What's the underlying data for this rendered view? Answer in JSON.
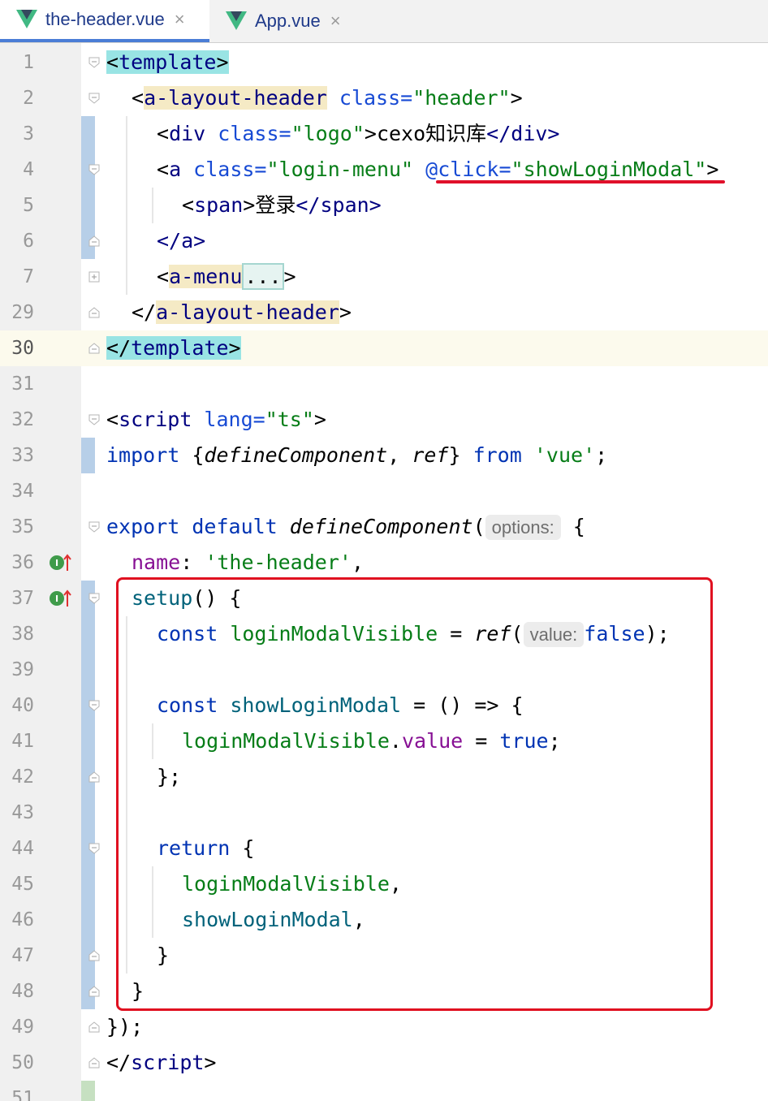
{
  "tabs": [
    {
      "label": "the-header.vue",
      "active": true
    },
    {
      "label": "App.vue",
      "active": false
    }
  ],
  "close_glyph": "×",
  "lines": [
    {
      "num": "1"
    },
    {
      "num": "2"
    },
    {
      "num": "3"
    },
    {
      "num": "4"
    },
    {
      "num": "5"
    },
    {
      "num": "6"
    },
    {
      "num": "7"
    },
    {
      "num": "29"
    },
    {
      "num": "30"
    },
    {
      "num": "31"
    },
    {
      "num": "32"
    },
    {
      "num": "33"
    },
    {
      "num": "34"
    },
    {
      "num": "35"
    },
    {
      "num": "36"
    },
    {
      "num": "37"
    },
    {
      "num": "38"
    },
    {
      "num": "39"
    },
    {
      "num": "40"
    },
    {
      "num": "41"
    },
    {
      "num": "42"
    },
    {
      "num": "43"
    },
    {
      "num": "44"
    },
    {
      "num": "45"
    },
    {
      "num": "46"
    },
    {
      "num": "47"
    },
    {
      "num": "48"
    },
    {
      "num": "49"
    },
    {
      "num": "50"
    },
    {
      "num": "51"
    }
  ],
  "code": {
    "l1": {
      "lt": "<",
      "tag": "template",
      "gt": ">"
    },
    "l2": {
      "lt": "<",
      "tag": "a-layout-header",
      "attr": " class=",
      "val": "\"header\"",
      "gt": ">"
    },
    "l3": {
      "lt": "<",
      "tag": "div",
      "attr": " class=",
      "val": "\"logo\"",
      "gt": ">",
      "text": "cexo知识库",
      "close": "</div>"
    },
    "l4": {
      "lt": "<",
      "tag": "a",
      "attr": " class=",
      "val": "\"login-menu\"",
      "event": "@click=",
      "handler": "\"showLoginModal\"",
      "gt": ">"
    },
    "l5": {
      "lt": "<",
      "tag": "span",
      "gt": ">",
      "text": "登录",
      "close": "</span>"
    },
    "l6": {
      "text": "</a>"
    },
    "l7": {
      "lt": "<",
      "tag": "a-menu",
      "fold": "...",
      "gt": ">"
    },
    "l29": {
      "lt": "</",
      "tag": "a-layout-header",
      "gt": ">"
    },
    "l30": {
      "lt": "</",
      "tag": "template",
      "gt": ">"
    },
    "l32": {
      "lt": "<",
      "tag": "script",
      "attr": " lang=",
      "val": "\"ts\"",
      "gt": ">"
    },
    "l33": {
      "kw": "import",
      "p1": " {",
      "fn": "defineComponent",
      "p2": ", ",
      "fn2": "ref",
      "p3": "} ",
      "kw2": "from",
      "p4": " ",
      "str": "'vue'",
      "p5": ";"
    },
    "l35": {
      "kw": "export default",
      "p1": " ",
      "fn": "defineComponent",
      "p2": "(",
      "hint": "options:",
      "p3": " {"
    },
    "l36": {
      "prop": "name",
      "p1": ": ",
      "str": "'the-header'",
      "p2": ","
    },
    "l37": {
      "fn": "setup",
      "p1": "() {"
    },
    "l38": {
      "kw": "const",
      "p1": " ",
      "var": "loginModalVisible",
      "p2": " = ",
      "fn": "ref",
      "p3": "(",
      "hint": "value:",
      "kw2": "false",
      "p4": ");"
    },
    "l40": {
      "kw": "const",
      "p1": " ",
      "var": "showLoginModal",
      "p2": " = () => {"
    },
    "l41": {
      "var": "loginModalVisible",
      "p1": ".",
      "prop": "value",
      "p2": " = ",
      "kw": "true",
      "p3": ";"
    },
    "l42": {
      "text": "};"
    },
    "l44": {
      "kw": "return",
      "p1": " {"
    },
    "l45": {
      "var": "loginModalVisible",
      "p1": ","
    },
    "l46": {
      "var": "showLoginModal",
      "p1": ","
    },
    "l47": {
      "text": "}"
    },
    "l48": {
      "text": "}"
    },
    "l49": {
      "text": "});"
    },
    "l50": {
      "lt": "</",
      "tag": "script",
      "gt": ">"
    }
  },
  "colors": {
    "tag": "#000080",
    "attribute": "#174ad4",
    "string": "#067d17",
    "keyword": "#0033b3",
    "property": "#871094",
    "annotation_red": "#e01020"
  },
  "icons": [
    "vue-logo-icon",
    "close-icon",
    "fold-icon",
    "implements-icon"
  ]
}
